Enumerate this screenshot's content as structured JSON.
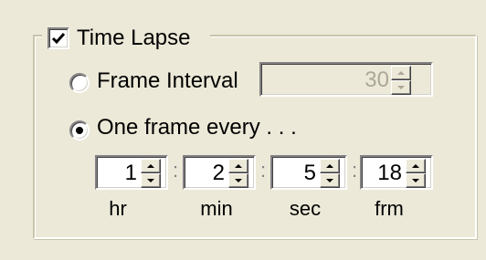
{
  "time_lapse": {
    "label": "Time Lapse",
    "checked": true,
    "frame_interval": {
      "label": "Frame Interval",
      "selected": false,
      "value": "30",
      "enabled": false
    },
    "one_frame_every": {
      "label": "One frame every . . .",
      "selected": true
    },
    "separators": [
      ":",
      ":",
      ":"
    ],
    "fields": [
      {
        "value": "1",
        "unit": "hr"
      },
      {
        "value": "2",
        "unit": "min"
      },
      {
        "value": "5",
        "unit": "sec"
      },
      {
        "value": "18",
        "unit": "frm"
      }
    ]
  },
  "icons": {
    "checkbox_mark": "checkmark-icon",
    "spin_up": "arrow-up-icon",
    "spin_down": "arrow-down-icon"
  }
}
